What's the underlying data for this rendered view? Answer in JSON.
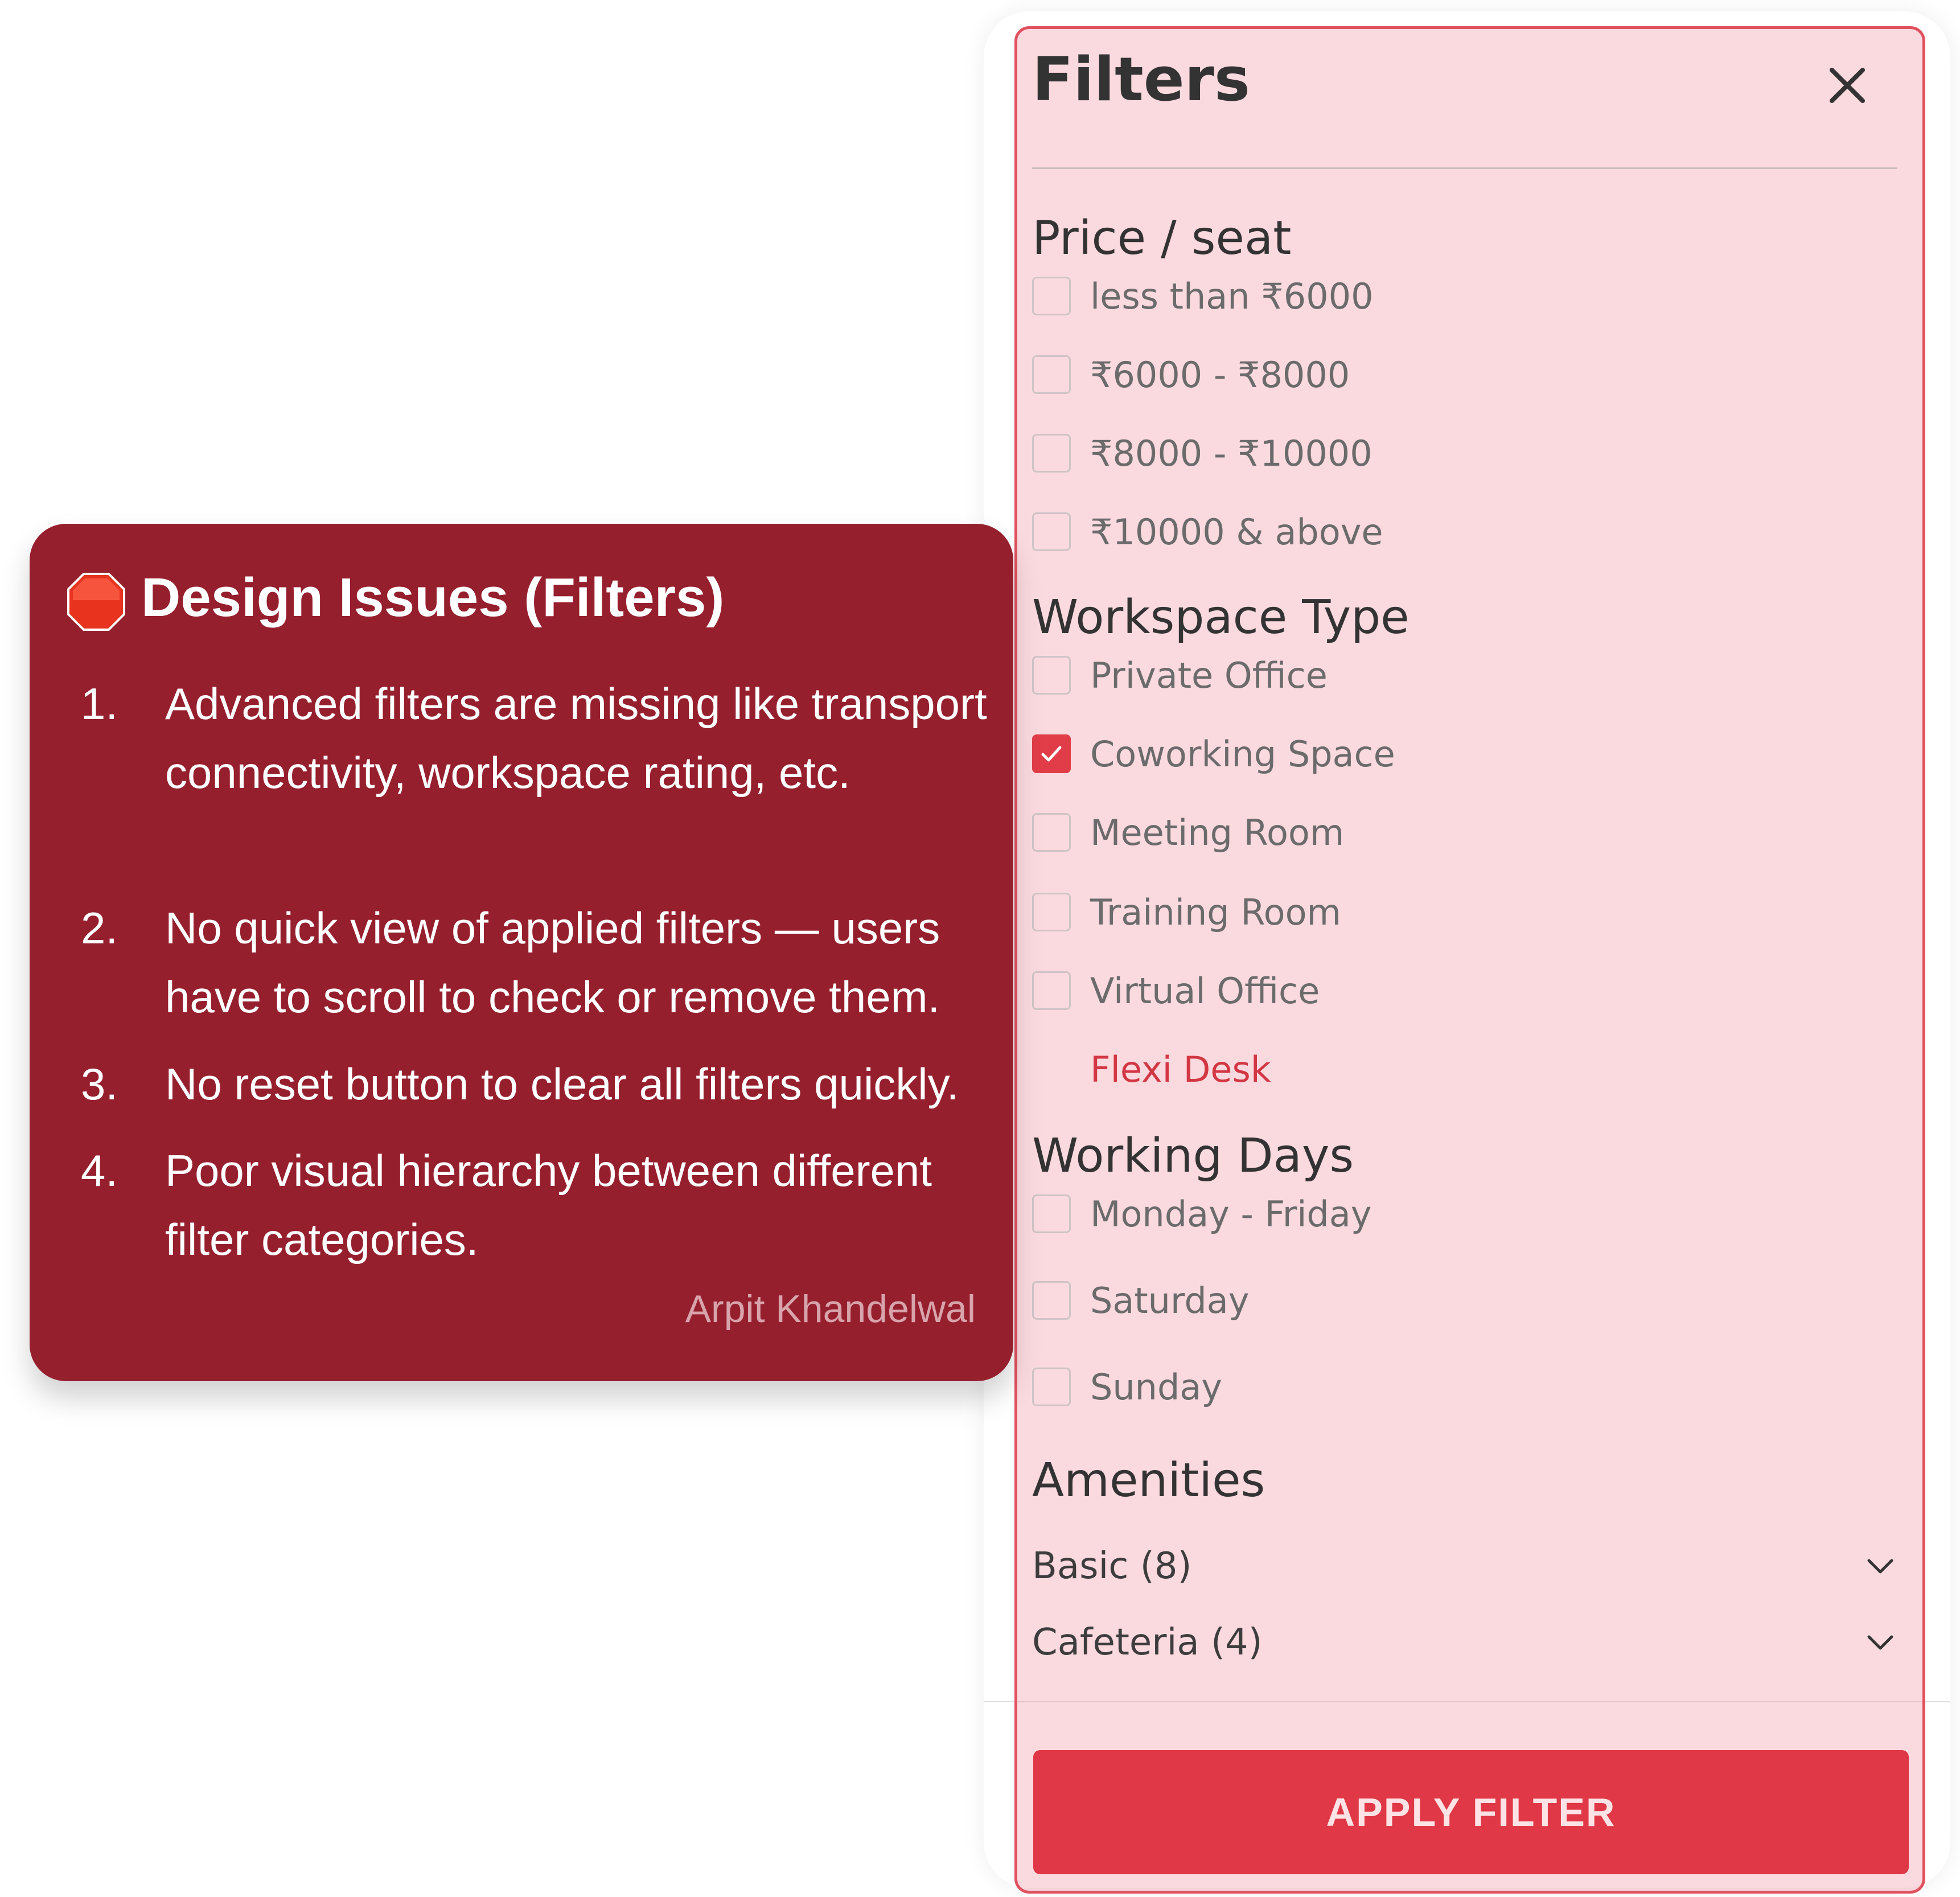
{
  "filters": {
    "title": "Filters",
    "price_section": {
      "title": "Price / seat",
      "options": [
        {
          "label": "less than ₹6000",
          "checked": false
        },
        {
          "label": "₹6000 - ₹8000",
          "checked": false
        },
        {
          "label": "₹8000 - ₹10000",
          "checked": false
        },
        {
          "label": "₹10000 & above",
          "checked": false
        }
      ]
    },
    "workspace_section": {
      "title": "Workspace Type",
      "options": [
        {
          "label": "Private Office",
          "checked": false
        },
        {
          "label": "Coworking Space",
          "checked": true
        },
        {
          "label": "Meeting Room",
          "checked": false
        },
        {
          "label": "Training Room",
          "checked": false
        },
        {
          "label": "Virtual Office",
          "checked": false
        },
        {
          "label": "Flexi Desk",
          "checked": false
        }
      ]
    },
    "days_section": {
      "title": "Working Days",
      "options": [
        {
          "label": "Monday - Friday",
          "checked": false
        },
        {
          "label": "Saturday",
          "checked": false
        },
        {
          "label": "Sunday",
          "checked": false
        }
      ]
    },
    "amenities_section": {
      "title": "Amenities",
      "groups": [
        {
          "label": "Basic (8)"
        },
        {
          "label": "Cafeteria (4)"
        }
      ]
    },
    "apply_label": "APPLY FILTER"
  },
  "issues_card": {
    "title": "Design Issues (Filters)",
    "items": [
      {
        "num": "1.",
        "text": "Advanced filters are missing like transport connectivity, workspace rating, etc."
      },
      {
        "num": "2.",
        "text": "No quick view of applied filters — users have to scroll to check or remove them."
      },
      {
        "num": "3.",
        "text": "No reset button to clear all filters quickly."
      },
      {
        "num": "4.",
        "text": "Poor visual hierarchy between different filter categories."
      }
    ],
    "author": "Arpit Khandelwal"
  },
  "colors": {
    "accent": "#e03846",
    "card_background": "#961f2e",
    "highlight_border": "#e0525f"
  },
  "icons": [
    "close-icon",
    "check-icon",
    "chevron-down-icon",
    "stop-sign-icon"
  ]
}
